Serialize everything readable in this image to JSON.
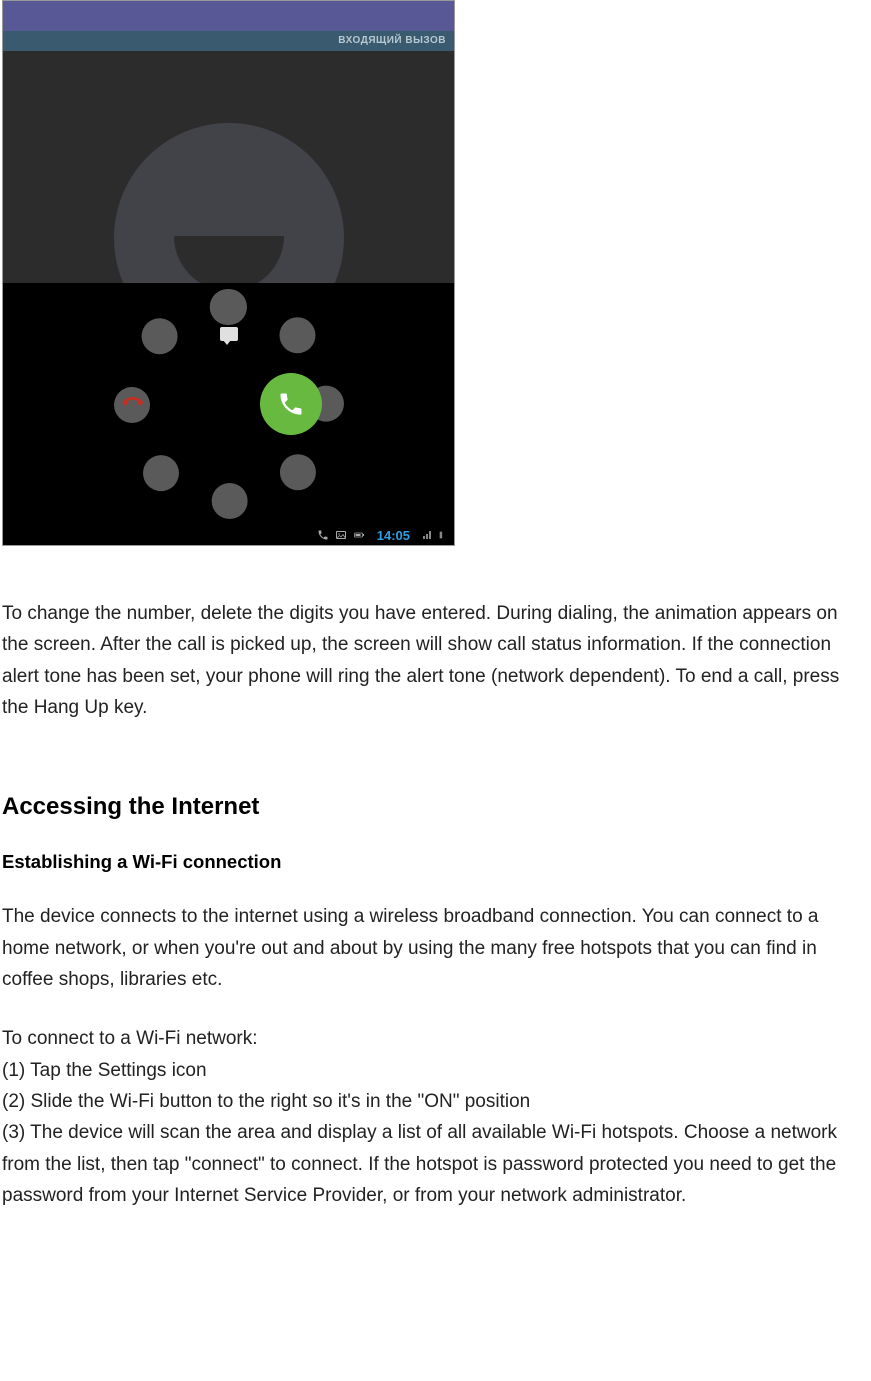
{
  "screenshot": {
    "incoming_label": "ВХОДЯЩИЙ ВЫЗОВ",
    "status_time": "14:05"
  },
  "body": {
    "para1": "To change the number, delete the digits you have entered. During dialing, the animation appears on the screen. After the call is picked up, the screen will show call status information. If the connection alert tone has been set, your phone will ring the alert tone (network dependent). To end a call, press the Hang Up key.",
    "heading": "Accessing the Internet",
    "subheading": "Establishing a Wi-Fi connection",
    "para2": "The device connects to the internet using a wireless broadband connection. You can connect to a home network, or when you're out and about by using the many free hotspots that you can find in coffee shops, libraries etc.",
    "steps_intro": "To connect to a Wi-Fi network:",
    "step1": "(1) Tap the Settings icon",
    "step2": "(2) Slide the Wi-Fi button to the right so it's in the \"ON\" position",
    "step3": "(3) The device will scan the area and display a list of all available Wi-Fi hotspots. Choose a network from the list, then tap \"connect\" to connect. If the hotspot is password protected you need to get the password from your Internet Service Provider, or from your network administrator."
  }
}
